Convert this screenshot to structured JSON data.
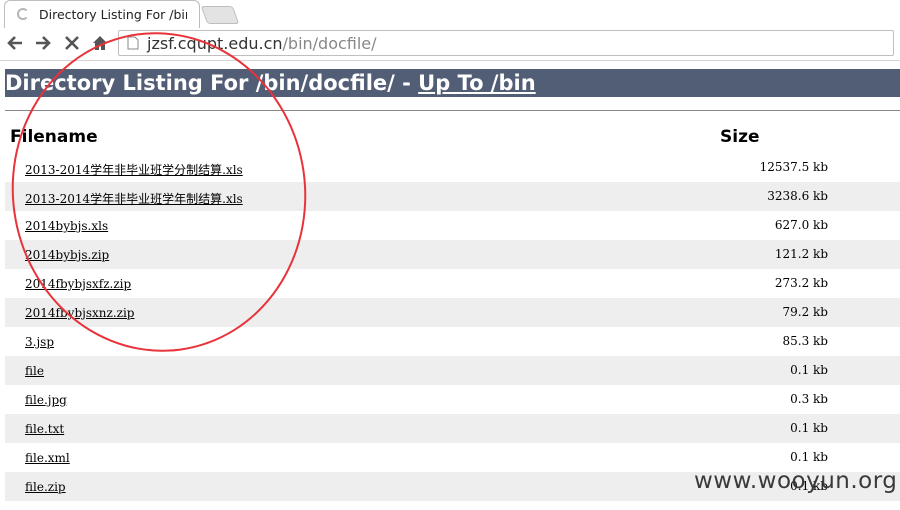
{
  "browser": {
    "tab_title": "Directory Listing For /bin",
    "url_host": "jzsf.cqupt.edu.cn",
    "url_path": "/bin/docfile/"
  },
  "page": {
    "banner_prefix": "Directory Listing For /bin/docfile/ - ",
    "banner_link": "Up To /bin",
    "col_filename": "Filename",
    "col_size": "Size",
    "files": [
      {
        "name": "2013-2014学年非毕业班学分制结算.xls",
        "size": "12537.5 kb"
      },
      {
        "name": "2013-2014学年非毕业班学年制结算.xls",
        "size": "3238.6 kb"
      },
      {
        "name": "2014bybjs.xls",
        "size": "627.0 kb"
      },
      {
        "name": "2014bybjs.zip",
        "size": "121.2 kb"
      },
      {
        "name": "2014fbybjsxfz.zip",
        "size": "273.2 kb"
      },
      {
        "name": "2014fbybjsxnz.zip",
        "size": "79.2 kb"
      },
      {
        "name": "3.jsp",
        "size": "85.3 kb"
      },
      {
        "name": "file",
        "size": "0.1 kb"
      },
      {
        "name": "file.jpg",
        "size": "0.3 kb"
      },
      {
        "name": "file.txt",
        "size": "0.1 kb"
      },
      {
        "name": "file.xml",
        "size": "0.1 kb"
      },
      {
        "name": "file.zip",
        "size": "0.1 kb"
      }
    ]
  },
  "overlay": {
    "watermark": "www.wooyun.org",
    "annotation_color": "#e8333a"
  },
  "colors": {
    "banner_bg": "#525d76",
    "alt_row_bg": "#eeeeee"
  },
  "icons": {
    "back": "arrow-left-icon",
    "forward": "arrow-right-icon",
    "stop": "close-icon",
    "home": "home-icon",
    "page": "page-icon",
    "loading": "spinner-icon"
  }
}
